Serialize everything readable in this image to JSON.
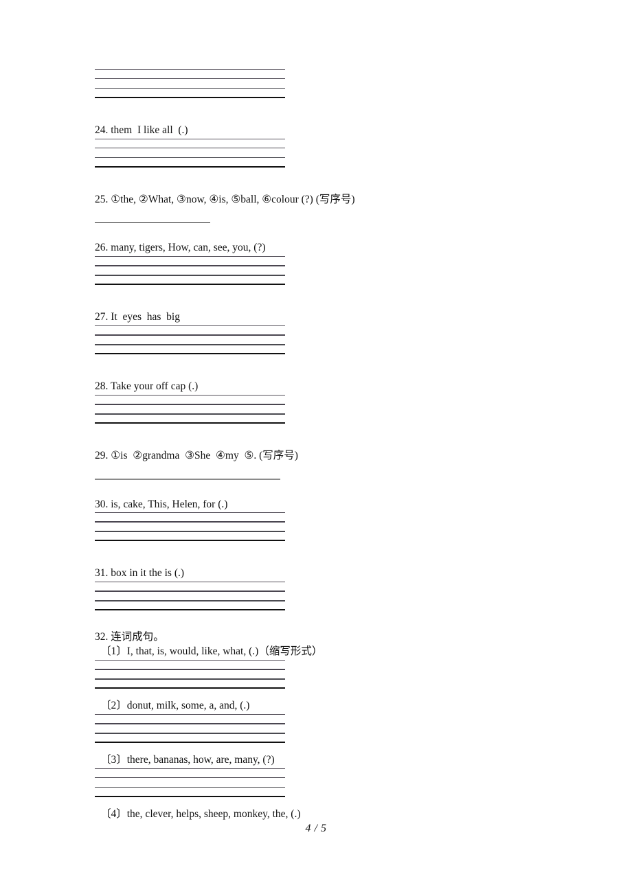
{
  "document": {
    "page_label": "4 / 5"
  },
  "items": [
    {
      "id": "item-top-guide",
      "text": "",
      "answer_style": "four-line-guide"
    },
    {
      "id": "item-24",
      "text": "24. them  I like all  (.)",
      "answer_style": "four-line-guide"
    },
    {
      "id": "item-25",
      "text": "25. ①the, ②What, ③now, ④is, ⑤ball, ⑥colour (?) (写序号)",
      "answer_style": "single-rule"
    },
    {
      "id": "item-26",
      "text": "26. many, tigers, How, can, see, you, (?)",
      "answer_style": "four-line-guide"
    },
    {
      "id": "item-27",
      "text": "27. It  eyes  has  big",
      "answer_style": "four-line-guide"
    },
    {
      "id": "item-28",
      "text": "28. Take your off cap (.)",
      "answer_style": "four-line-guide"
    },
    {
      "id": "item-29",
      "text": "29. ①is  ②grandma  ③She  ④my  ⑤. (写序号)",
      "answer_style": "single-rule-light"
    },
    {
      "id": "item-30",
      "text": "30. is, cake, This, Helen, for (.)",
      "answer_style": "four-line-guide"
    },
    {
      "id": "item-31",
      "text": "31. box in it the is (.)",
      "answer_style": "four-line-guide"
    }
  ],
  "item32": {
    "heading": "32. 连词成句。",
    "subitems": [
      {
        "id": "item-32-1",
        "text": "〔1〕I, that, is, would, like, what, (.)（缩写形式）",
        "answer_style": "four-line-guide"
      },
      {
        "id": "item-32-2",
        "text": "〔2〕donut, milk, some, a, and, (.)",
        "answer_style": "four-line-guide"
      },
      {
        "id": "item-32-3",
        "text": "〔3〕there, bananas, how, are, many, (?)",
        "answer_style": "four-line-guide"
      },
      {
        "id": "item-32-4",
        "text": "〔4〕the, clever, helps, sheep, monkey, the, (.)",
        "answer_style": "none"
      }
    ]
  }
}
